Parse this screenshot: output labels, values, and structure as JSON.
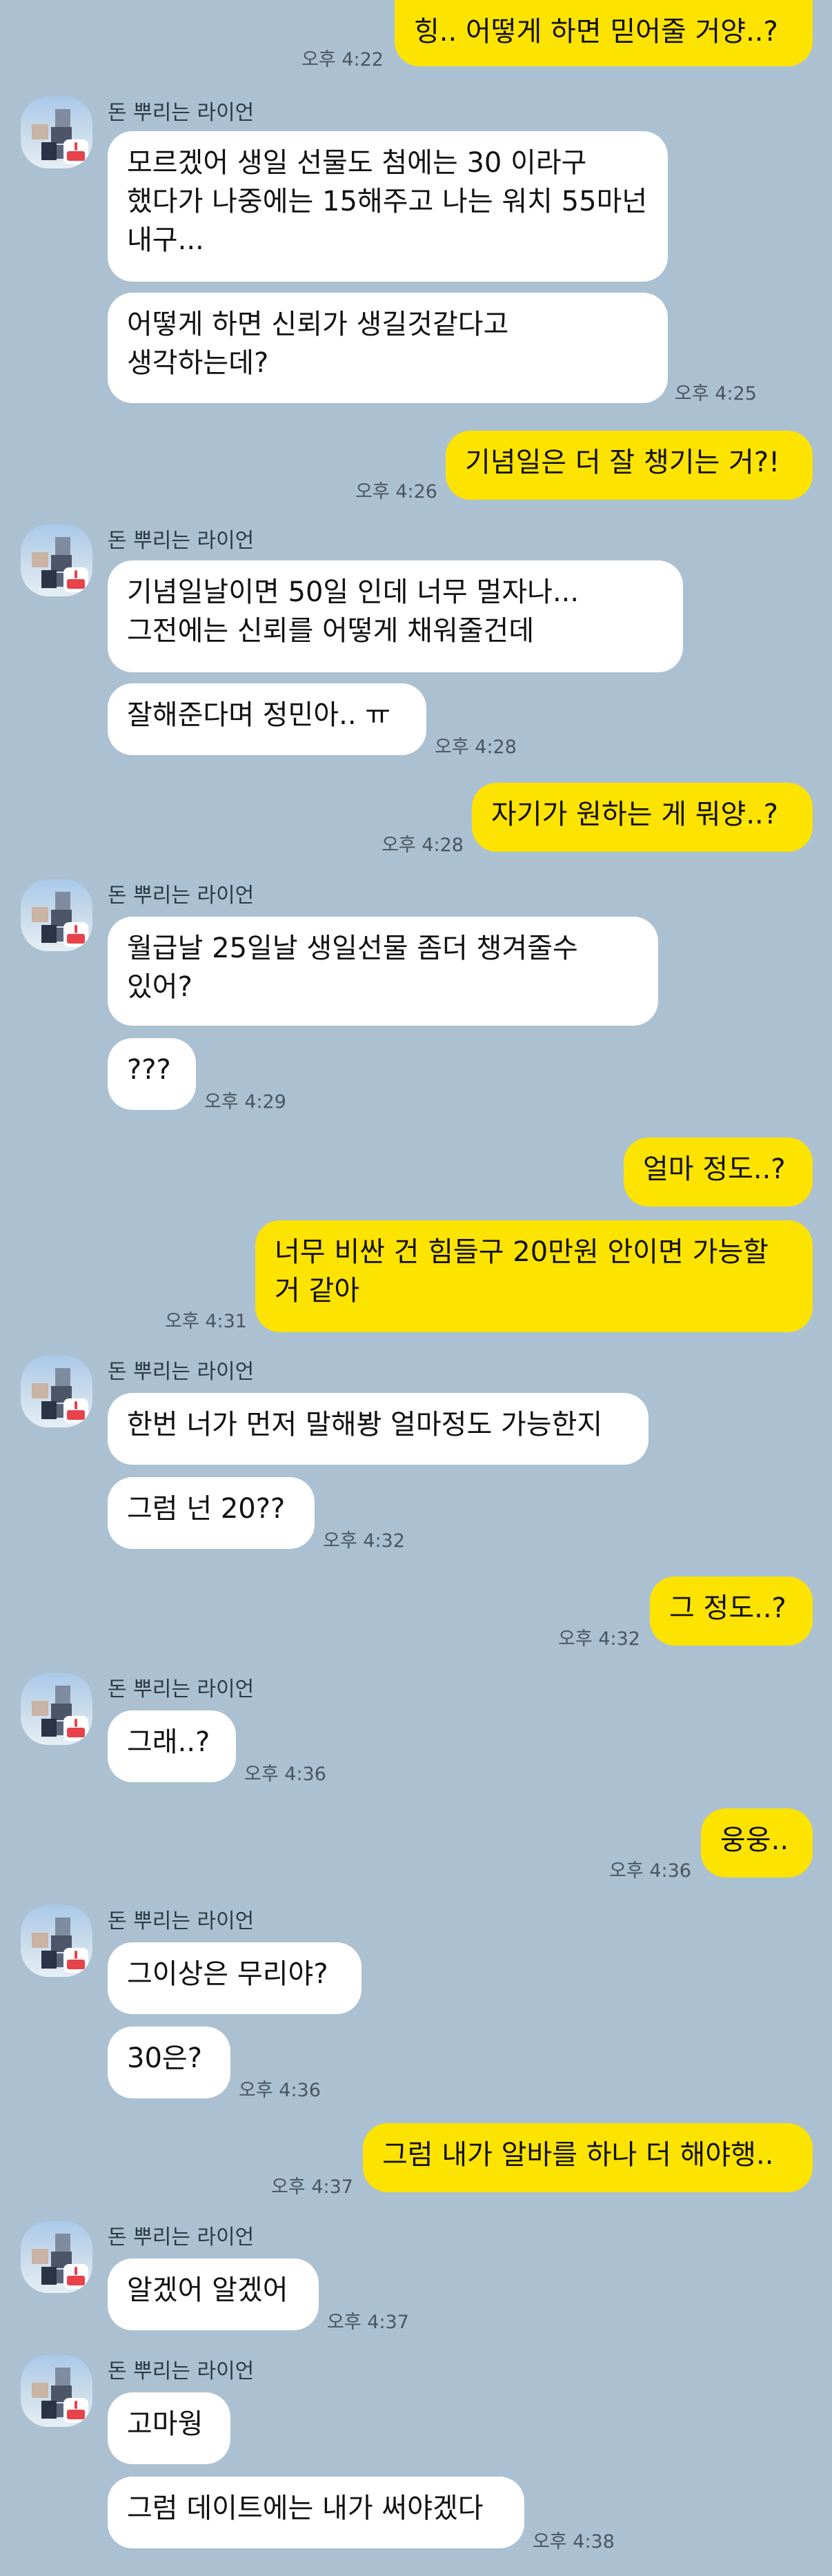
{
  "app": {
    "name": "KakaoTalk chat"
  },
  "contact": {
    "name": "돈 뿌리는 라이언"
  },
  "messages": [
    {
      "from": "me",
      "text": "힝.. 어떻게 하면 믿어줄 거양..?",
      "time": "오후 4:22"
    },
    {
      "from": "them",
      "show_name": true,
      "text": "모르겠어 생일 선물도 첨에는 30 이라구 했다가 나중에는 15해주고 나는 워치 55마넌 내구...",
      "time": ""
    },
    {
      "from": "them",
      "show_name": false,
      "text": "어떻게 하면 신뢰가 생길것같다고 생각하는데?",
      "time": "오후 4:25"
    },
    {
      "from": "me",
      "text": "기념일은 더 잘 챙기는 거?!",
      "time": "오후 4:26"
    },
    {
      "from": "them",
      "show_name": true,
      "text": "기념일날이면 50일 인데 너무 멀자나... 그전에는 신뢰를 어떻게 채워줄건데",
      "time": ""
    },
    {
      "from": "them",
      "show_name": false,
      "text": "잘해준다며 정민아.. ㅠ",
      "time": "오후 4:28"
    },
    {
      "from": "me",
      "text": "자기가 원하는 게 뭐양..?",
      "time": "오후 4:28"
    },
    {
      "from": "them",
      "show_name": true,
      "text": "월급날 25일날 생일선물 좀더 챙겨줄수 있어?",
      "time": ""
    },
    {
      "from": "them",
      "show_name": false,
      "text": "???",
      "time": "오후 4:29"
    },
    {
      "from": "me",
      "text": "얼마 정도..?",
      "time": ""
    },
    {
      "from": "me",
      "text": "너무 비싼 건 힘들구 20만원 안이면 가능할 거 같아",
      "time": "오후 4:31"
    },
    {
      "from": "them",
      "show_name": true,
      "text": "한번 너가 먼저 말해봥 얼마정도 가능한지",
      "time": ""
    },
    {
      "from": "them",
      "show_name": false,
      "text": "그럼 넌 20??",
      "time": "오후 4:32"
    },
    {
      "from": "me",
      "text": "그 정도..?",
      "time": "오후 4:32"
    },
    {
      "from": "them",
      "show_name": true,
      "text": "그래..?",
      "time": "오후 4:36"
    },
    {
      "from": "me",
      "text": "웅웅..",
      "time": "오후 4:36"
    },
    {
      "from": "them",
      "show_name": true,
      "text": "그이상은 무리야?",
      "time": ""
    },
    {
      "from": "them",
      "show_name": false,
      "text": "30은?",
      "time": "오후 4:36"
    },
    {
      "from": "me",
      "text": "그럼 내가 알바를 하나 더 해야행..",
      "time": "오후 4:37"
    },
    {
      "from": "them",
      "show_name": true,
      "text": "알겠어 알겠어",
      "time": "오후 4:37"
    },
    {
      "from": "them",
      "show_name": true,
      "text": "고마웡",
      "time": ""
    },
    {
      "from": "them",
      "show_name": false,
      "text": "그럼 데이트에는 내가 써야겠다",
      "time": "오후 4:38"
    }
  ],
  "colors": {
    "background": "#abc1d1",
    "my_bubble": "#fde300",
    "their_bubble": "#ffffff"
  }
}
